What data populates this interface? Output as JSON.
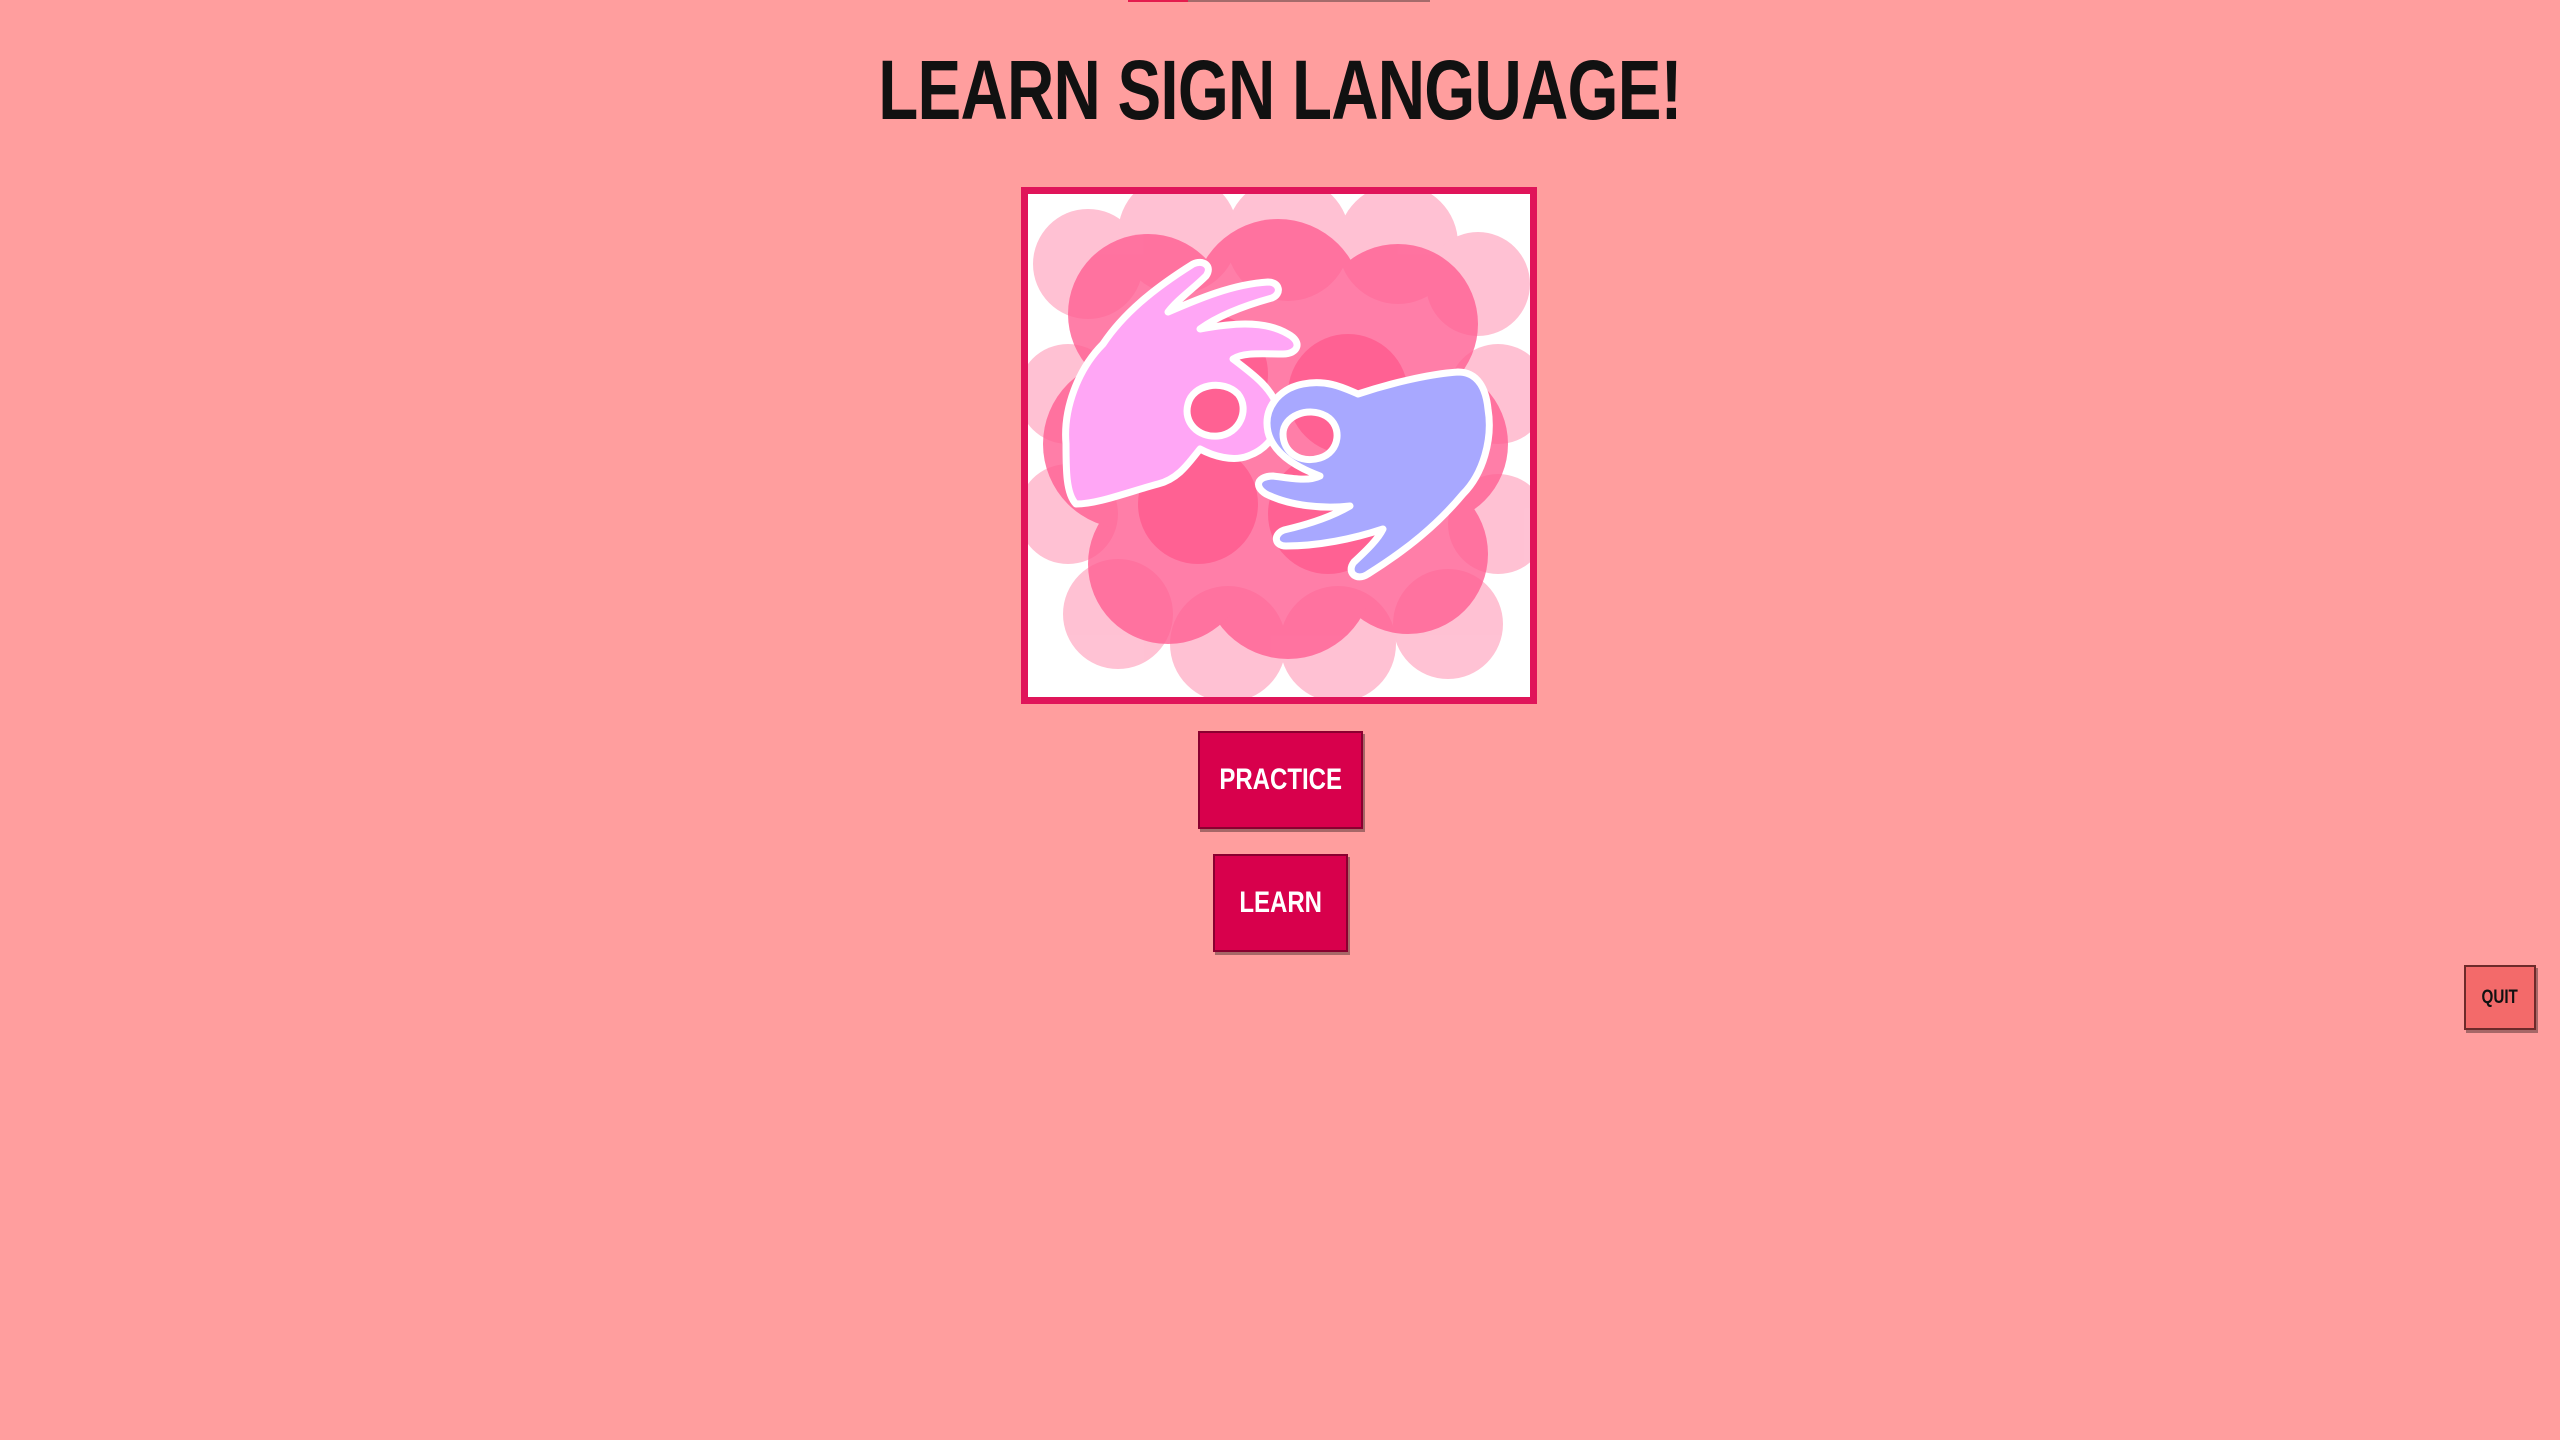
{
  "title": "LEARN SIGN LANGUAGE!",
  "logo": {
    "icon": "sign-language-hands-icon",
    "frame_color": "#e0155a",
    "left_hand_color": "#ffa6f5",
    "right_hand_color": "#a8a8ff",
    "cloud_color": "#ff5f93"
  },
  "buttons": {
    "practice_label": "PRACTICE",
    "learn_label": "LEARN",
    "quit_label": "QUIT"
  },
  "colors": {
    "background": "#ff9e9e",
    "primary_button": "#d8004c",
    "quit_button": "#f36a6a",
    "title_text": "#111111"
  }
}
